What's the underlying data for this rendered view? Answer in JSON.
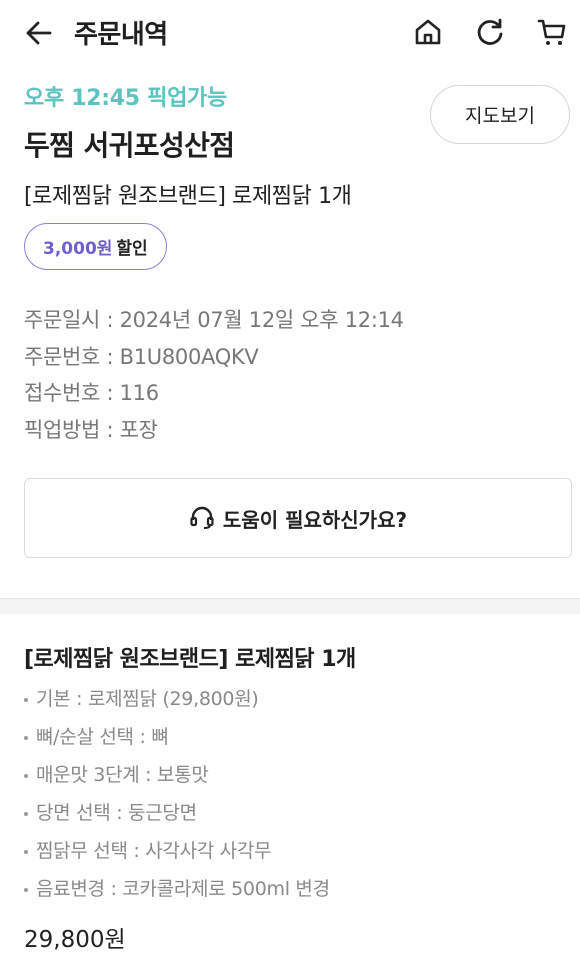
{
  "header": {
    "title": "주문내역",
    "back_icon": "arrow-left-icon",
    "home_icon": "home-icon",
    "refresh_icon": "refresh-icon",
    "cart_icon": "cart-icon"
  },
  "store": {
    "pickup_time": "오후 12:45 픽업가능",
    "name": "두찜 서귀포성산점",
    "map_button": "지도보기",
    "order_summary": "[로제찜닭 원조브랜드] 로제찜닭 1개"
  },
  "discount": {
    "amount": "3,000원",
    "label": "할인"
  },
  "order_info": [
    "주문일시 : 2024년 07월 12일 오후 12:14",
    "주문번호 : B1U800AQKV",
    "접수번호 : 116",
    "픽업방법 : 포장"
  ],
  "help": {
    "label": "도움이 필요하신가요?",
    "icon": "headset-icon"
  },
  "menu": {
    "title": "[로제찜닭 원조브랜드] 로제찜닭 1개",
    "options": [
      "기본 : 로제찜닭 (29,800원)",
      "뼈/순살 선택 : 뼈",
      "매운맛 3단계 : 보통맛",
      "당면 선택 : 둥근당면",
      "찜닭무 선택 : 사각사각 사각무",
      "음료변경 : 코카콜라제로 500ml 변경"
    ],
    "price": "29,800원"
  },
  "colors": {
    "accent_teal": "#5cc3bf",
    "discount_purple": "#6f5fd0"
  }
}
